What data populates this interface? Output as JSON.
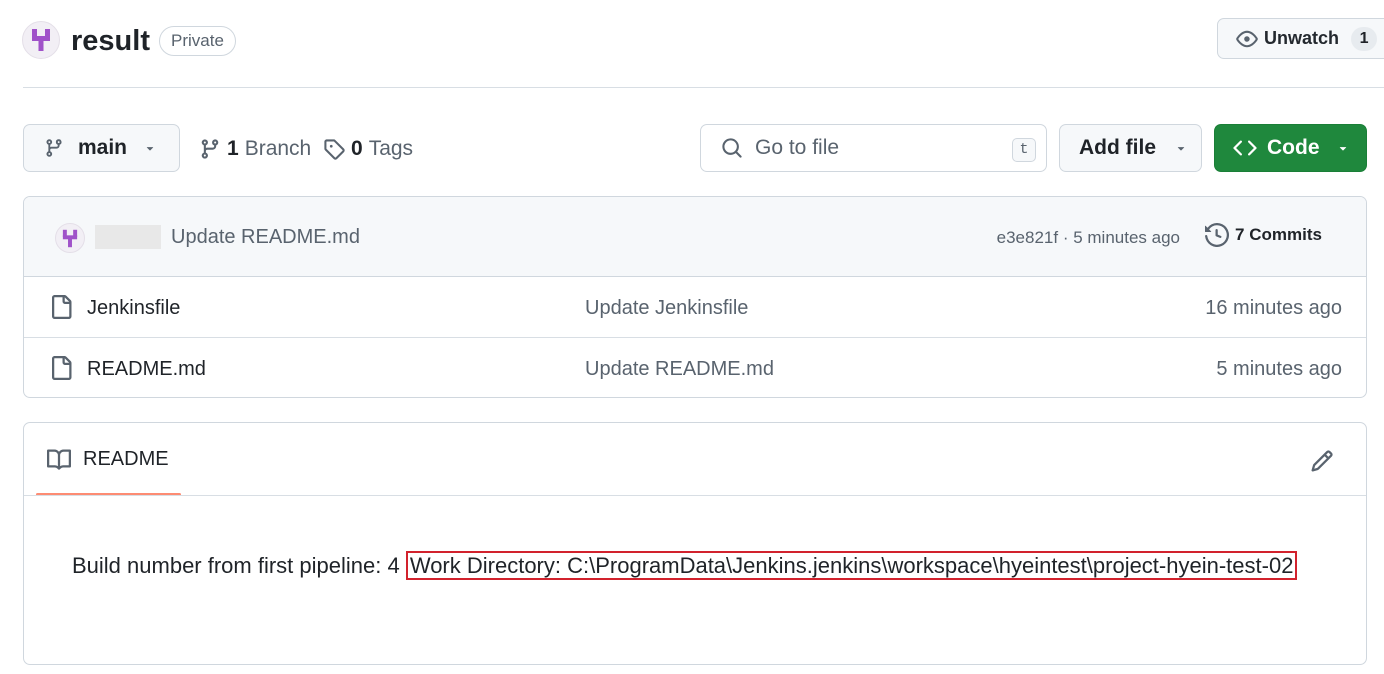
{
  "repo": {
    "name": "result",
    "visibility": "Private",
    "unwatch_label": "Unwatch",
    "watch_count": "1",
    "avatar_icon": "pipeline-logo-icon"
  },
  "toolbar": {
    "branch": "main",
    "branches_count": "1",
    "branches_label": "Branch",
    "tags_count": "0",
    "tags_label": "Tags",
    "search_placeholder": "Go to file",
    "search_shortcut": "t",
    "add_file_label": "Add file",
    "code_label": "Code",
    "code_color": "#1f883d"
  },
  "latest_commit": {
    "message": "Update README.md",
    "hash": "e3e821f",
    "time": "5 minutes ago",
    "commits_count": "7",
    "commits_label": "Commits"
  },
  "files": [
    {
      "name": "Jenkinsfile",
      "commit": "Update Jenkinsfile",
      "age": "16 minutes ago"
    },
    {
      "name": "README.md",
      "commit": "Update README.md",
      "age": "5 minutes ago"
    }
  ],
  "readme": {
    "tab_label": "README",
    "text_before": "Build number from first pipeline: 4 ",
    "highlighted_text": "Work Directory: C:\\ProgramData\\Jenkins.jenkins\\workspace\\hyeintest\\project-hyein-test-02",
    "highlight_color": "#d2222d",
    "tab_accent": "#fd8c73"
  }
}
